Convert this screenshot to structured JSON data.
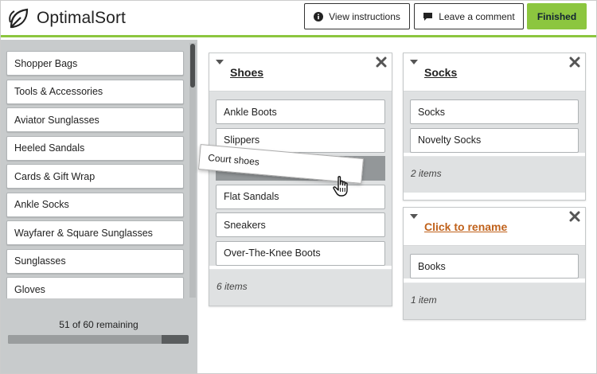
{
  "app": {
    "name": "OptimalSort"
  },
  "header": {
    "view_instructions": "View instructions",
    "leave_comment": "Leave a comment",
    "finished": "Finished"
  },
  "cards": [
    "Shopper Bags",
    "Tools & Accessories",
    "Aviator Sunglasses",
    "Heeled Sandals",
    "Cards & Gift Wrap",
    "Ankle Socks",
    "Wayfarer & Square Sunglasses",
    "Sunglasses",
    "Gloves"
  ],
  "progress": {
    "remaining_text": "51 of 60 remaining",
    "sorted_fraction": 0.85
  },
  "groups": {
    "shoes": {
      "title": "Shoes",
      "items": [
        "Ankle Boots",
        "Slippers",
        "Flat Sandals",
        "Sneakers",
        "Over-The-Knee Boots"
      ],
      "count": "6 items"
    },
    "socks": {
      "title": "Socks",
      "items": [
        "Socks",
        "Novelty Socks"
      ],
      "count": "2 items"
    },
    "rename": {
      "title": "Click to rename",
      "items": [
        "Books"
      ],
      "count": "1 item"
    }
  },
  "dragging": {
    "label": "Court shoes"
  },
  "colors": {
    "accent": "#8cc63f",
    "rename_link": "#c0621c",
    "panel_gray": "#c8cbcc"
  }
}
